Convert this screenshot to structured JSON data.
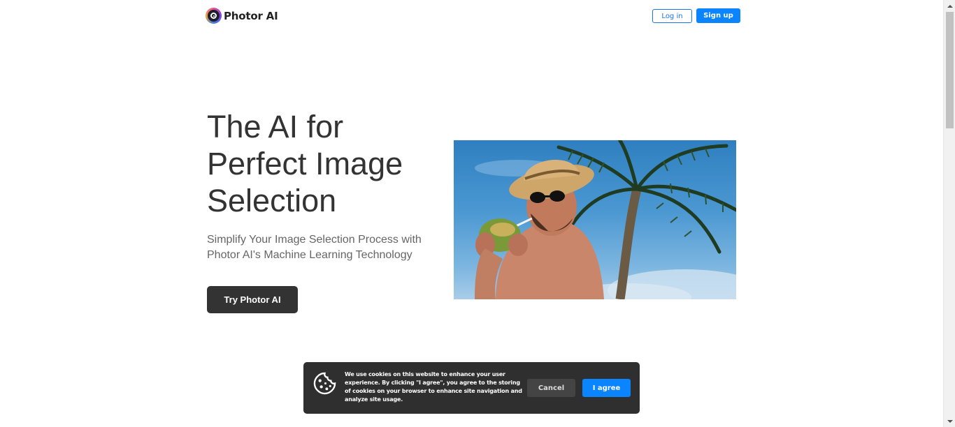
{
  "header": {
    "brand": "Photor AI",
    "login_label": "Log in",
    "signup_label": "Sign up"
  },
  "hero": {
    "title_line1": "The AI for",
    "title_line2": "Perfect Image",
    "title_line3": "Selection",
    "subtitle": "Simplify Your Image Selection Process with Photor AI's Machine Learning Technology",
    "cta_label": "Try Photor AI",
    "image_subject": "man in straw hat and sunglasses drinking from a coconut under a palm tree"
  },
  "cookie_banner": {
    "text_part1": "We use cookies on this website to enhance your user experience. By clicking ",
    "text_bold": "\"I agree\"",
    "text_part2": ", you agree to the storing of cookies on your browser to enhance site navigation and analyze site usage.",
    "cancel_label": "Cancel",
    "agree_label": "I agree"
  },
  "colors": {
    "accent": "#0a84ff",
    "dark_button": "#333333",
    "banner_bg": "#2f2f2f"
  },
  "icons": {
    "logo": "camera-lens-icon",
    "cookie": "cookie-icon"
  }
}
